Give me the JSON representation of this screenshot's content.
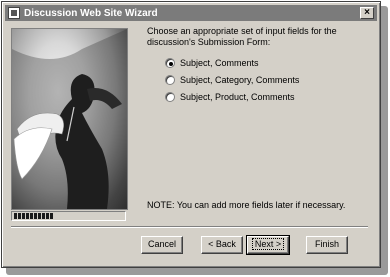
{
  "window": {
    "title": "Discussion Web Site Wizard",
    "close_glyph": "×"
  },
  "content": {
    "prompt": "Choose an appropriate set of input fields for the discussion's Submission Form:",
    "options": [
      {
        "label": "Subject, Comments",
        "selected": true
      },
      {
        "label": "Subject, Category, Comments",
        "selected": false
      },
      {
        "label": "Subject, Product, Comments",
        "selected": false
      }
    ],
    "note": "NOTE: You can add more fields later if necessary."
  },
  "progress": {
    "filled_blocks": 10
  },
  "buttons": {
    "cancel": "Cancel",
    "back": "< Back",
    "next": "Next >",
    "finish": "Finish"
  },
  "icons": {
    "app": "wizard-app-icon",
    "close": "close-icon"
  }
}
